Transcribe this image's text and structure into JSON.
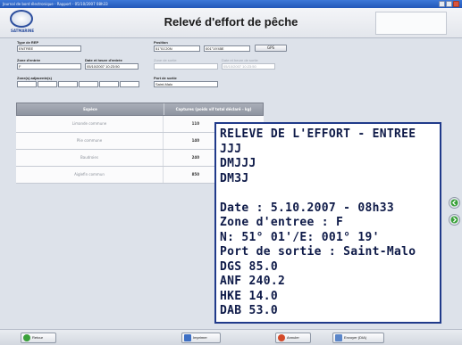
{
  "window": {
    "title": "Journal de bord électronique - Rapport - 05/10/2007 08h33"
  },
  "header": {
    "title": "Relevé d'effort de pêche",
    "logo_text": "SATMARINE"
  },
  "form": {
    "type_label": "Type de REP",
    "type_value": "ENTREE",
    "position_label": "Position",
    "lat_value": "51°01'20N",
    "lon_value": "001°19'45E",
    "gps_label": "GPS",
    "zone_label": "Zone d'entrée",
    "zone_value": "F",
    "entry_dt_label": "Date et heure d'entrée",
    "entry_dt_value": "05/10/2007 10:23:50",
    "exit_zone_label": "Zone de sortie",
    "exit_zone_value": "",
    "exit_dt_label": "Date et heure de sortie",
    "exit_dt_value": "05/10/2007 10:23:50",
    "adj_label": "Zone(s) adjacente(s)",
    "port_label": "Port de sortie",
    "port_value": "Saint-Malo"
  },
  "grid": {
    "col1": "Espèce",
    "col2": "Captures (poids vif total déclaré - kg)",
    "rows": [
      {
        "species": "Limande commune",
        "qty": "110"
      },
      {
        "species": "Plie commune",
        "qty": "140"
      },
      {
        "species": "Baudroies",
        "qty": "240"
      },
      {
        "species": "Aiglefin commun",
        "qty": "850"
      }
    ]
  },
  "report": {
    "lines": [
      "RELEVE DE L'EFFORT - ENTREE",
      "JJJ",
      "DMJJJ",
      "DM3J",
      "",
      "Date : 5.10.2007 - 08h33",
      "Zone d'entree : F",
      "N: 51° 01'/E: 001° 19'",
      "Port de sortie : Saint-Malo",
      "DGS 85.0",
      "ANF 240.2",
      "HKE 14.0",
      "DAB 53.0"
    ]
  },
  "footer": {
    "retour": "Retour",
    "imprimer": "Imprimer",
    "annuler": "Annuler",
    "envoyer": "Envoyer (DIA)"
  },
  "colors": {
    "accent": "#203a8a",
    "header_grid": "#8e94a0",
    "ok": "#3aa13a",
    "cancel": "#d34a2a"
  }
}
